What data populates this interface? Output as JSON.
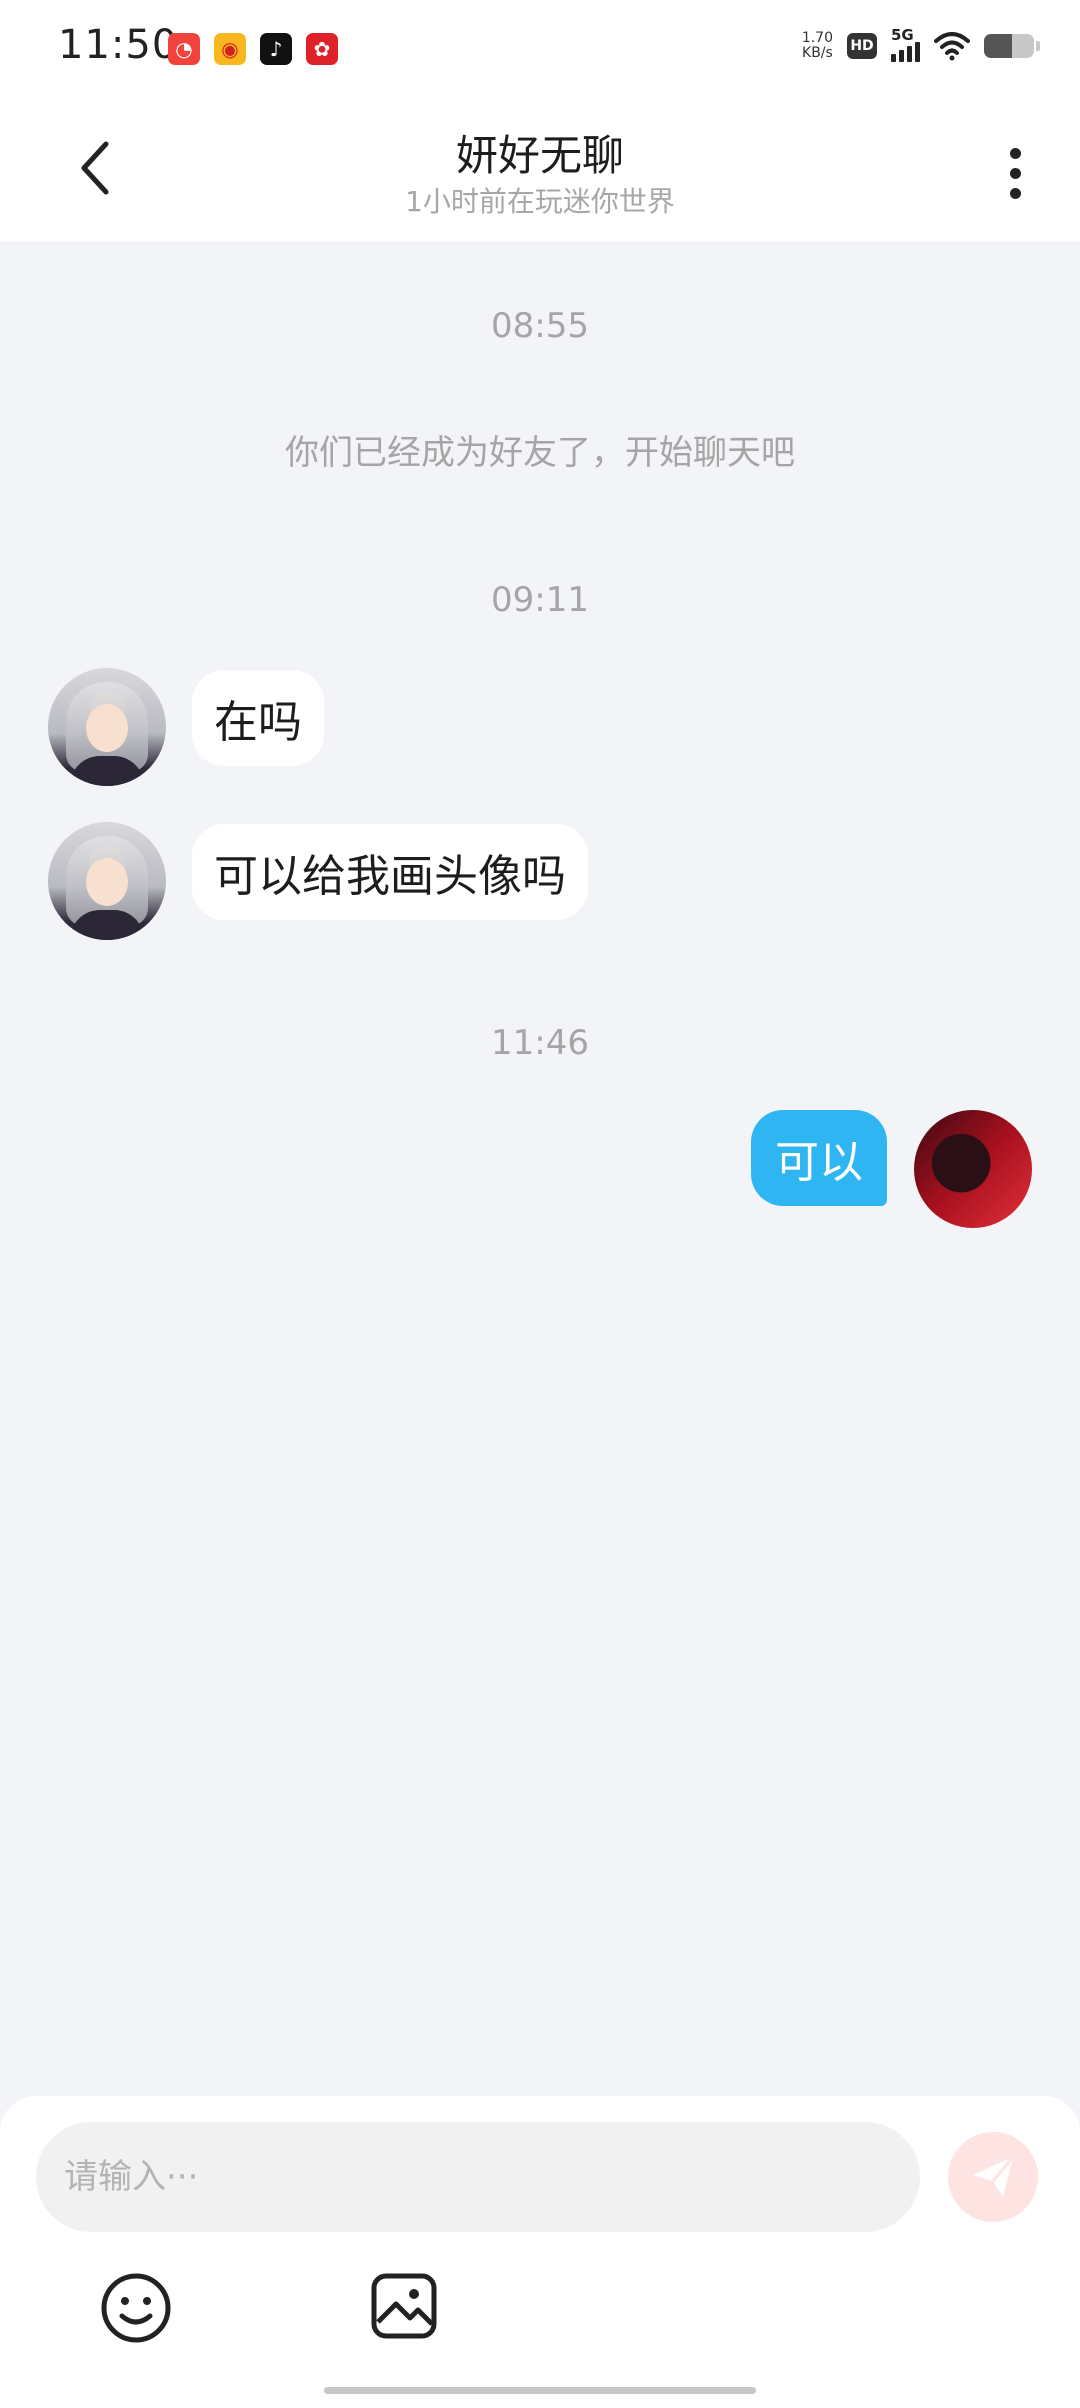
{
  "status_bar": {
    "time": "11:50",
    "notification_icons": [
      "app-icon-1",
      "weibo-icon",
      "tiktok-icon",
      "app-icon-4"
    ],
    "net_speed_value": "1.70",
    "net_speed_unit": "KB/s",
    "hd_label": "HD",
    "network_type": "5G",
    "battery_level": 0.55
  },
  "header": {
    "title": "妍好无聊",
    "subtitle": "1小时前在玩迷你世界"
  },
  "chat": {
    "time_1": "08:55",
    "system_message": "你们已经成为好友了，开始聊天吧",
    "time_2": "09:11",
    "messages_received": [
      {
        "text": "在吗"
      },
      {
        "text": "可以给我画头像吗"
      }
    ],
    "time_3": "11:46",
    "messages_sent": [
      {
        "text": "可以"
      }
    ]
  },
  "input": {
    "placeholder": "请输入···",
    "value": ""
  },
  "colors": {
    "sent_bubble": "#2fb6f2",
    "received_bubble": "#ffffff",
    "chat_background": "#f3f4f7",
    "send_button": "#fde4e2"
  }
}
